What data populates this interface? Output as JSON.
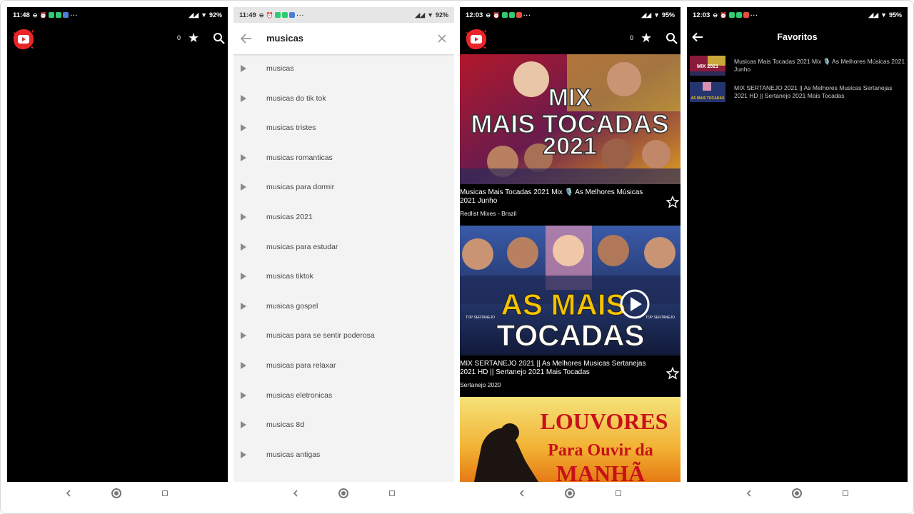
{
  "screens": [
    {
      "status": {
        "time": "11:48",
        "battery": "92%"
      },
      "counter": "0"
    },
    {
      "status": {
        "time": "11:49",
        "battery": "92%"
      },
      "search": {
        "query": "musicas"
      },
      "suggestions": [
        "musicas",
        "musicas do tik tok",
        "musicas tristes",
        "musicas romanticas",
        "musicas para dormir",
        "musicas 2021",
        "musicas para estudar",
        "musicas tiktok",
        "musicas gospel",
        "musicas para se sentir poderosa",
        "musicas para relaxar",
        "musicas eletronicas",
        "musicas 8d",
        "musicas antigas"
      ]
    },
    {
      "status": {
        "time": "12:03",
        "battery": "95%"
      },
      "counter": "0",
      "videos": [
        {
          "thumb_lines": [
            "MIX",
            "MAIS TOCADAS",
            "2021"
          ],
          "title": "Musicas Mais Tocadas 2021 Mix 🎙️ As Melhores Músicas 2021 Junho",
          "channel": "Redlist Mixes - Brazil"
        },
        {
          "thumb_lines": [
            "AS MAIS",
            "TOCADAS"
          ],
          "thumb_side": "TOP SERTANEJO",
          "title": "MIX SERTANEJO 2021 || As Melhores Musicas Sertanejas 2021 HD || Sertanejo 2021 Mais Tocadas",
          "channel": "Sertanejo 2020"
        },
        {
          "thumb_lines": [
            "LOUVORES",
            "Para Ouvir da",
            "MANHÃ"
          ]
        }
      ]
    },
    {
      "status": {
        "time": "12:03",
        "battery": "95%"
      },
      "title": "Favoritos",
      "favorites": [
        {
          "title": "Musicas Mais Tocadas 2021 Mix 🎙️ As Melhores Músicas 2021 Junho",
          "thumb_text": "MIX 2021"
        },
        {
          "title": "MIX SERTANEJO 2021 || As Melhores Musicas Sertanejas 2021 HD || Sertanejo 2021 Mais Tocadas",
          "thumb_text": "AS MAIS TOCADAS"
        }
      ]
    }
  ]
}
